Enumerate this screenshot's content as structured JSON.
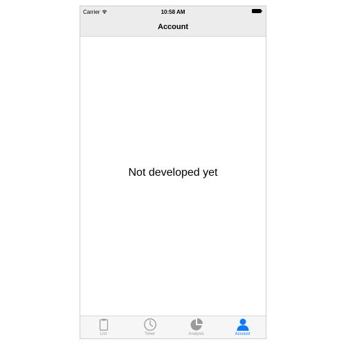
{
  "status_bar": {
    "carrier": "Carrier",
    "time": "10:58 AM",
    "wifi_icon": "wifi-icon",
    "battery_icon": "battery-icon"
  },
  "nav": {
    "title": "Account"
  },
  "main": {
    "message": "Not developed yet"
  },
  "tab_bar": {
    "tabs": [
      {
        "label": "List",
        "icon": "clipboard-icon",
        "active": false
      },
      {
        "label": "Timer",
        "icon": "clock-icon",
        "active": false
      },
      {
        "label": "Analysis",
        "icon": "pie-chart-icon",
        "active": false
      },
      {
        "label": "Account",
        "icon": "person-icon",
        "active": true
      }
    ]
  },
  "colors": {
    "accent": "#0a7aff",
    "inactive": "#9a9a9a",
    "bar_background": "#ececec"
  }
}
